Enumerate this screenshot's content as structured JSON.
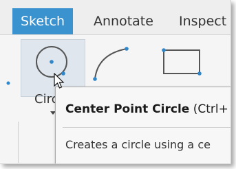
{
  "ribbon": {
    "tabs": [
      {
        "label": "Sketch",
        "active": true
      },
      {
        "label": "Annotate",
        "active": false
      },
      {
        "label": "Inspect",
        "active": false
      }
    ],
    "tools": {
      "circle": {
        "label": "Circ",
        "icon": "circle-icon"
      },
      "arc": {
        "icon": "arc-icon"
      },
      "rectangle": {
        "icon": "rectangle-icon"
      }
    }
  },
  "tooltip": {
    "title": "Center Point Circle",
    "shortcut": "(Ctrl+",
    "description": "Creates a circle using a ce"
  },
  "colors": {
    "accent": "#3a92cf",
    "point": "#2f86c9",
    "icon_stroke": "#555555"
  }
}
